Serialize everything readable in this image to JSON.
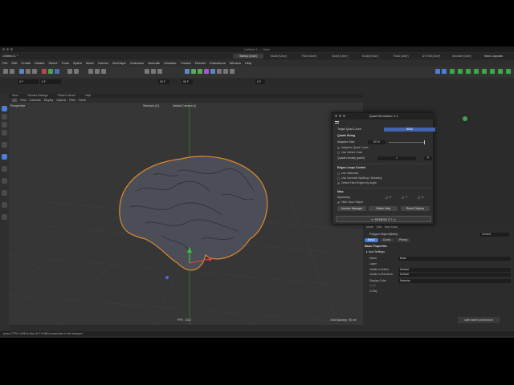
{
  "window": {
    "title": "Untitled 1 — Main"
  },
  "topbar": {
    "file_tab": "Untitled 1 *",
    "layout_tabs": [
      "Startup (User)",
      "Model (User)",
      "Paint (User)",
      "Script (User)",
      "Sculpt (User)",
      "Track (User)",
      "UV Edit (User)",
      "Animate (User)"
    ],
    "new_layouts": "New Layouts"
  },
  "menubar": [
    "File",
    "Edit",
    "Create",
    "Modes",
    "Select",
    "Tools",
    "Spline",
    "Mesh",
    "Volume",
    "MoGraph",
    "Character",
    "Animate",
    "Simulate",
    "Tracker",
    "Render",
    "Extensions",
    "Window",
    "Help"
  ],
  "coords": {
    "x": "0 F",
    "y": "0 F",
    "z": "90 F",
    "w": "90 F",
    "v": "0 F"
  },
  "viewport": {
    "tabs": [
      "View",
      "Render Settings",
      "Picture Viewer",
      "Help"
    ],
    "menu": [
      "View",
      "Cameras",
      "Display",
      "Options",
      "Filter",
      "Panel"
    ],
    "label": "Perspective",
    "center_label": "Standard (D)",
    "camera_label": "Default Camera (•)",
    "fps": "FPS : 33.3",
    "grid_spacing": "Grid Spacing : 50 cm"
  },
  "status": {
    "text": "press CTRL+LMB to find, ALT+LMB to maximize in the viewport"
  },
  "quad_remesher": {
    "title": "Quad Remesher 1.1",
    "target_label": "Target Quad Count",
    "target_value": "5000",
    "quads_sizing": "Quads Sizing",
    "adaptive_size_label": "Adaptive Size",
    "adaptive_size_value": "50 %",
    "adaptive_quad_count": "Adaptive Quad Count",
    "use_vertex_color": "Use Vertex Color",
    "density_label": "Quads Density (paint)",
    "density_value": "1",
    "edge_loops": "Edges Loops Control",
    "use_materials": "Use Materials",
    "use_normals": "Use Normals Splitting / Breaking",
    "detect_hard_edges": "Detect Hard Edges by Angle",
    "misc": "Misc",
    "symmetry": "Symmetry",
    "sym_x": "X",
    "sym_y": "Y",
    "sym_z": "Z",
    "hide_input": "Hide Input Object",
    "license_manager": "License Manager",
    "online_help": "Online Help",
    "reset_options": "Reset Options",
    "remesh_button": "<< REMESH IT ! >>"
  },
  "attributes": {
    "tabs": [
      "Mode",
      "Edit",
      "User Data"
    ],
    "object_title": "Polygon Object [Brain]",
    "default_label": "Default",
    "pills": [
      "Basic",
      "Coord.",
      "Phong"
    ],
    "basic_properties": "Basic Properties",
    "icon_settings": "▸ Icon Settings",
    "rows": [
      {
        "label": "Name",
        "value": "Brain"
      },
      {
        "label": "Layer",
        "value": ""
      },
      {
        "label": "Visible in Editor",
        "value": "Default"
      },
      {
        "label": "Visible in Renderer",
        "value": "Default"
      },
      {
        "label": "Display Color",
        "value": "Material"
      },
      {
        "label": "Color",
        "value": ""
      },
      {
        "label": "X-Ray",
        "value": ""
      }
    ]
  },
  "watermark": {
    "url": "cafe.naver.com/kuroon"
  },
  "colors": {
    "accent": "#4a7fd6",
    "selection": "#e08a2c",
    "brain": "#4b4e57"
  }
}
